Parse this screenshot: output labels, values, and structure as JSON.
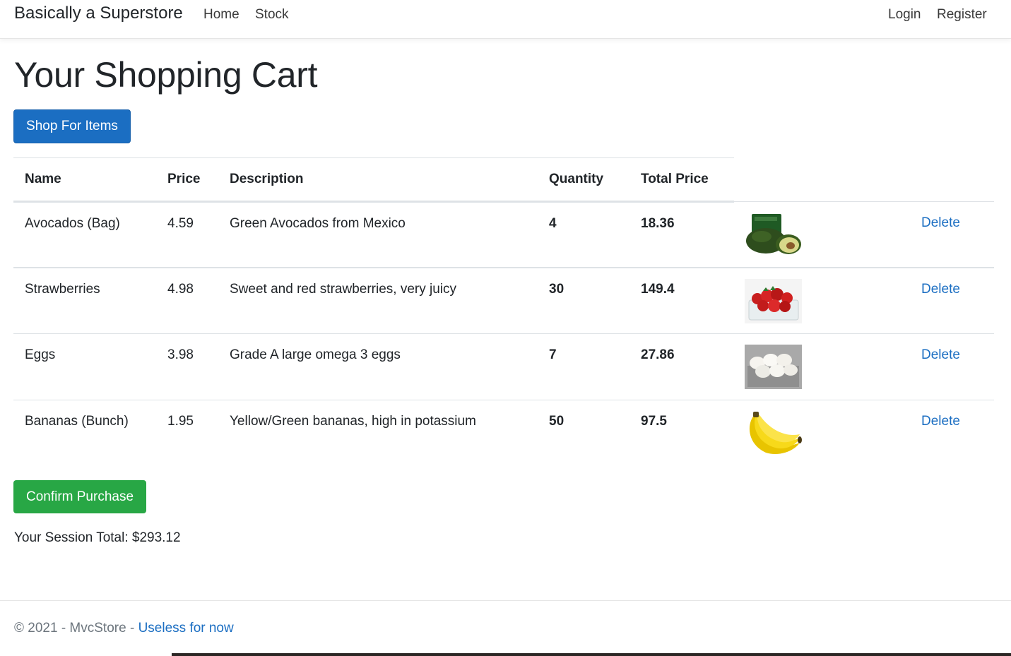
{
  "nav": {
    "brand": "Basically a Superstore",
    "links": [
      "Home",
      "Stock"
    ],
    "auth": [
      "Login",
      "Register"
    ]
  },
  "page": {
    "title": "Your Shopping Cart",
    "shop_button": "Shop For Items",
    "confirm_button": "Confirm Purchase",
    "session_total": "Your Session Total: $293.12"
  },
  "table": {
    "headers": [
      "Name",
      "Price",
      "Description",
      "Quantity",
      "Total Price"
    ],
    "delete_label": "Delete",
    "rows": [
      {
        "name": "Avocados (Bag)",
        "price": "4.59",
        "description": "Green Avocados from Mexico",
        "quantity": "4",
        "total": "18.36",
        "image": "avocado-image"
      },
      {
        "name": "Strawberries",
        "price": "4.98",
        "description": "Sweet and red strawberries, very juicy",
        "quantity": "30",
        "total": "149.4",
        "image": "strawberries-image"
      },
      {
        "name": "Eggs",
        "price": "3.98",
        "description": "Grade A large omega 3 eggs",
        "quantity": "7",
        "total": "27.86",
        "image": "eggs-image"
      },
      {
        "name": "Bananas (Bunch)",
        "price": "1.95",
        "description": "Yellow/Green bananas, high in potassium",
        "quantity": "50",
        "total": "97.5",
        "image": "bananas-image"
      }
    ]
  },
  "footer": {
    "text": "© 2021 - MvcStore - ",
    "link": "Useless for now"
  },
  "colors": {
    "primary": "#1b6ec2",
    "success": "#28a745",
    "border": "#dee2e6",
    "muted": "#6c757d"
  }
}
